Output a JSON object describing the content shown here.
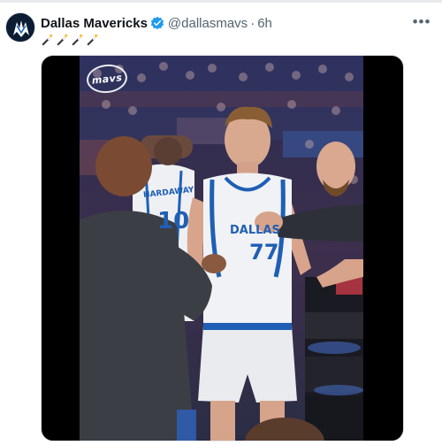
{
  "post": {
    "author_name": "Dallas Mavericks",
    "handle": "@dallasmavs",
    "separator": "·",
    "timestamp": "6h",
    "more_label": "•••",
    "text_emojis": [
      "magic-wand",
      "magic-wand",
      "magic-wand",
      "magic-wand"
    ]
  },
  "media": {
    "type": "video",
    "watermark": "mavs",
    "jersey_main_name": "DALLAS",
    "jersey_main_number": "77",
    "jersey_back_name": "HARDAWAY",
    "jersey_back_number": "10"
  },
  "colors": {
    "verified_badge": "#1d9bf0",
    "text_primary": "#0f1419",
    "text_secondary": "#536471",
    "mavs_blue": "#1f5fb4"
  }
}
